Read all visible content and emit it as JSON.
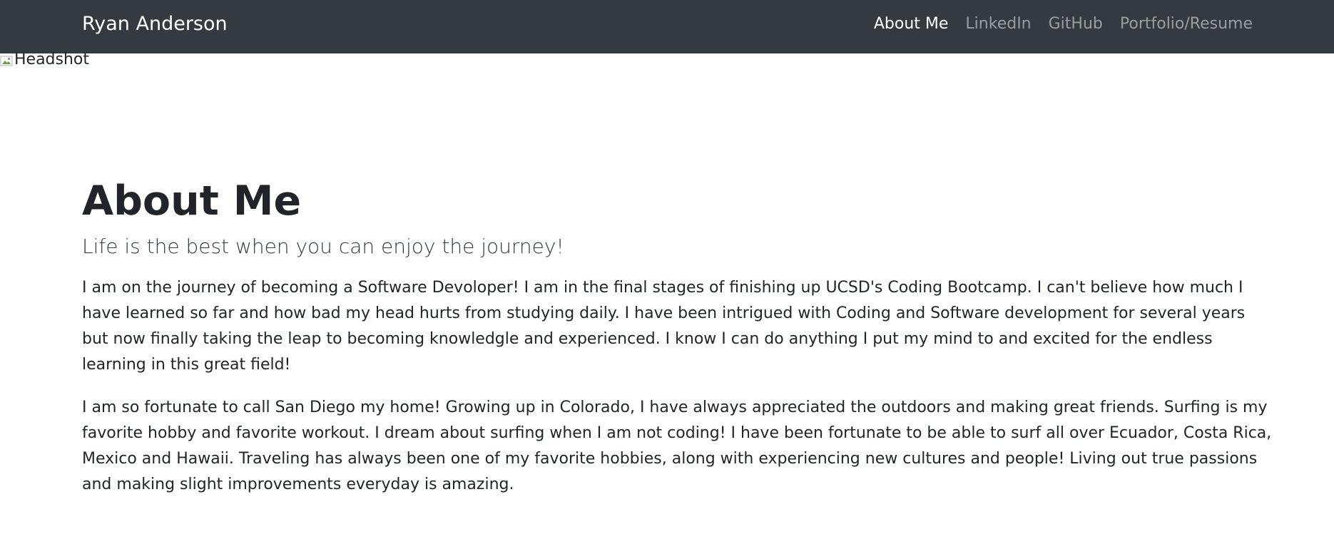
{
  "navbar": {
    "brand": "Ryan Anderson",
    "links": [
      {
        "label": "About Me",
        "active": true
      },
      {
        "label": "LinkedIn",
        "active": false
      },
      {
        "label": "GitHub",
        "active": false
      },
      {
        "label": "Portfolio/Resume",
        "active": false
      }
    ]
  },
  "headshot": {
    "alt": "Headshot",
    "icon": "broken-image-icon"
  },
  "main": {
    "title": "About Me",
    "subtitle": "Life is the best when you can enjoy the journey!",
    "paragraphs": [
      "I am on the journey of becoming a Software Devoloper! I am in the final stages of finishing up UCSD's Coding Bootcamp. I can't believe how much I have learned so far and how bad my head hurts from studying daily. I have been intrigued with Coding and Software development for several years but now finally taking the leap to becoming knowledgle and experienced. I know I can do anything I put my mind to and excited for the endless learning in this great field!",
      "I am so fortunate to call San Diego my home! Growing up in Colorado, I have always appreciated the outdoors and making great friends. Surfing is my favorite hobby and favorite workout. I dream about surfing when I am not coding! I have been fortunate to be able to surf all over Ecuador, Costa Rica, Mexico and Hawaii. Traveling has always been one of my favorite hobbies, along with experiencing new cultures and people! Living out true passions and making slight improvements everyday is amazing."
    ]
  },
  "colors": {
    "navbar_bg": "#343a40",
    "text": "#212529",
    "nav_active": "#ffffff",
    "nav_inactive": "rgba(255,255,255,0.5)"
  }
}
